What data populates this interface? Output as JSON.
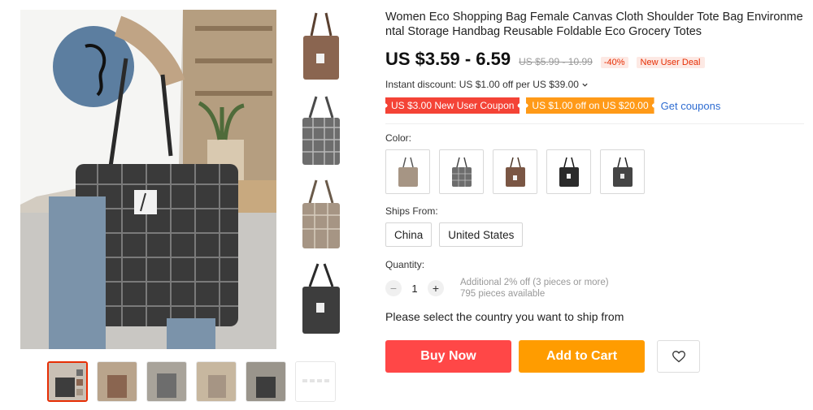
{
  "product": {
    "title": "Women Eco Shopping Bag Female Canvas Cloth Shoulder Tote Bag Environmental Storage Handbag Reusable Foldable Eco Grocery Totes",
    "price": "US $3.59 - 6.59",
    "original_price": "US $5.99 - 10.99",
    "discount_pct": "-40%",
    "deal_badge": "New User Deal",
    "instant_discount": "Instant discount: US $1.00 off per US $39.00"
  },
  "coupons": {
    "red_label": "US $3.00 New User Coupon",
    "orange_label": "US $1.00 off on US $20.00",
    "get_label": "Get coupons"
  },
  "color": {
    "label": "Color:",
    "swatches": [
      "gray-beige",
      "gray-plaid",
      "brown",
      "black",
      "dark-gray"
    ]
  },
  "ships": {
    "label": "Ships From:",
    "options": [
      "China",
      "United States"
    ]
  },
  "quantity": {
    "label": "Quantity:",
    "minus": "−",
    "value": "1",
    "plus": "+",
    "discount_note": "Additional 2% off (3 pieces or more)",
    "available": "795 pieces available"
  },
  "ship_note": "Please select the country you want to ship from",
  "actions": {
    "buy_label": "Buy Now",
    "cart_label": "Add to Cart",
    "wishlist_icon": "heart-icon"
  },
  "colors": {
    "buy": "#ff4747",
    "cart": "#ff9c00",
    "coupon_red": "#f44336",
    "coupon_orange": "#ff9a18",
    "link": "#2e6cd1",
    "accent": "#e62e04"
  }
}
